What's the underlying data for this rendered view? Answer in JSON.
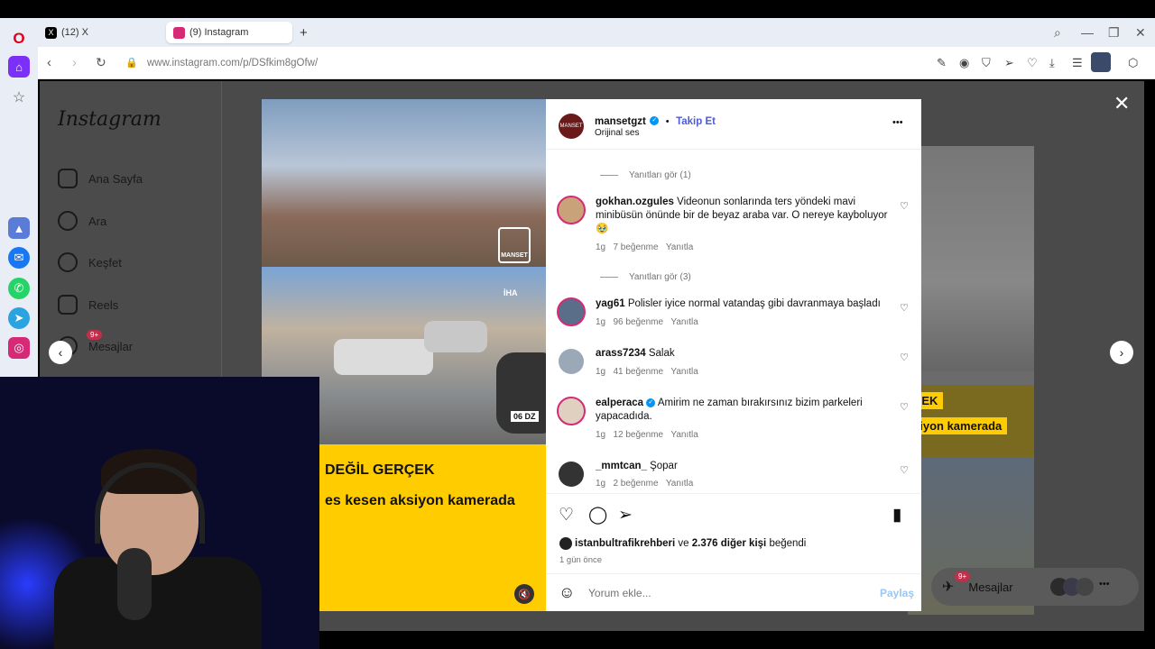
{
  "browser": {
    "tabs": [
      {
        "label": "(12) X"
      },
      {
        "label": "(9) Instagram"
      }
    ],
    "url_domain": "www.instagram.com",
    "url_path": "/p/DSfkim8gOfw/"
  },
  "sidebar": {
    "logo": "Instagram",
    "items": [
      {
        "label": "Ana Sayfa"
      },
      {
        "label": "Ara"
      },
      {
        "label": "Keşfet"
      },
      {
        "label": "Reels"
      },
      {
        "label": "Mesajlar",
        "badge": "9+"
      }
    ]
  },
  "video": {
    "watermark": "MANSET",
    "watermark2": "İHA",
    "plate": "06 DZ",
    "caption_line1": "DEĞİL GERÇEK",
    "caption_line2": "es kesen aksiyon kamerada"
  },
  "background_feed": {
    "caption_line1": "ÇEK",
    "caption_line2": "siyon kamerada"
  },
  "post": {
    "author": "mansetgzt",
    "follow": "Takip Et",
    "audio": "Orijinal ses",
    "more": "•••",
    "comments": [
      {
        "type": "replies",
        "label": "Yanıtları gör (1)"
      },
      {
        "user": "gokhan.ozgules",
        "text": "Videonun sonlarında ters yöndeki mavi minibüsün önünde bir de beyaz araba var. O nereye kayboluyor 🥹",
        "time": "1g",
        "likes": "7 beğenme",
        "reply": "Yanıtla"
      },
      {
        "type": "replies",
        "label": "Yanıtları gör (3)"
      },
      {
        "user": "yag61",
        "text": "Polisler iyice normal vatandaş gibi davranmaya başladı",
        "time": "1g",
        "likes": "96 beğenme",
        "reply": "Yanıtla"
      },
      {
        "user": "arass7234",
        "text": "Salak",
        "time": "1g",
        "likes": "41 beğenme",
        "reply": "Yanıtla"
      },
      {
        "user": "ealperaca",
        "text": "Amirim ne zaman bırakırsınız bizim parkeleri yapacadıda.",
        "time": "1g",
        "likes": "12 beğenme",
        "reply": "Yanıtla"
      },
      {
        "user": "_mmtcan_",
        "text": "Şopar",
        "time": "1g",
        "likes": "2 beğenme",
        "reply": "Yanıtla"
      }
    ],
    "liked_by_user": "istanbultrafikrehberi",
    "liked_by_rest_pre": "ve",
    "liked_by_count": "2.376 diğer kişi",
    "liked_by_suffix": "beğendi",
    "ago": "1 gün önce",
    "comment_placeholder": "Yorum ekle...",
    "share": "Paylaş"
  },
  "messages_pill": {
    "label": "Mesajlar",
    "badge": "9+"
  },
  "colors": {
    "accent": "#0095f6",
    "follow": "#4f5bd5",
    "badge": "#c0304a"
  }
}
